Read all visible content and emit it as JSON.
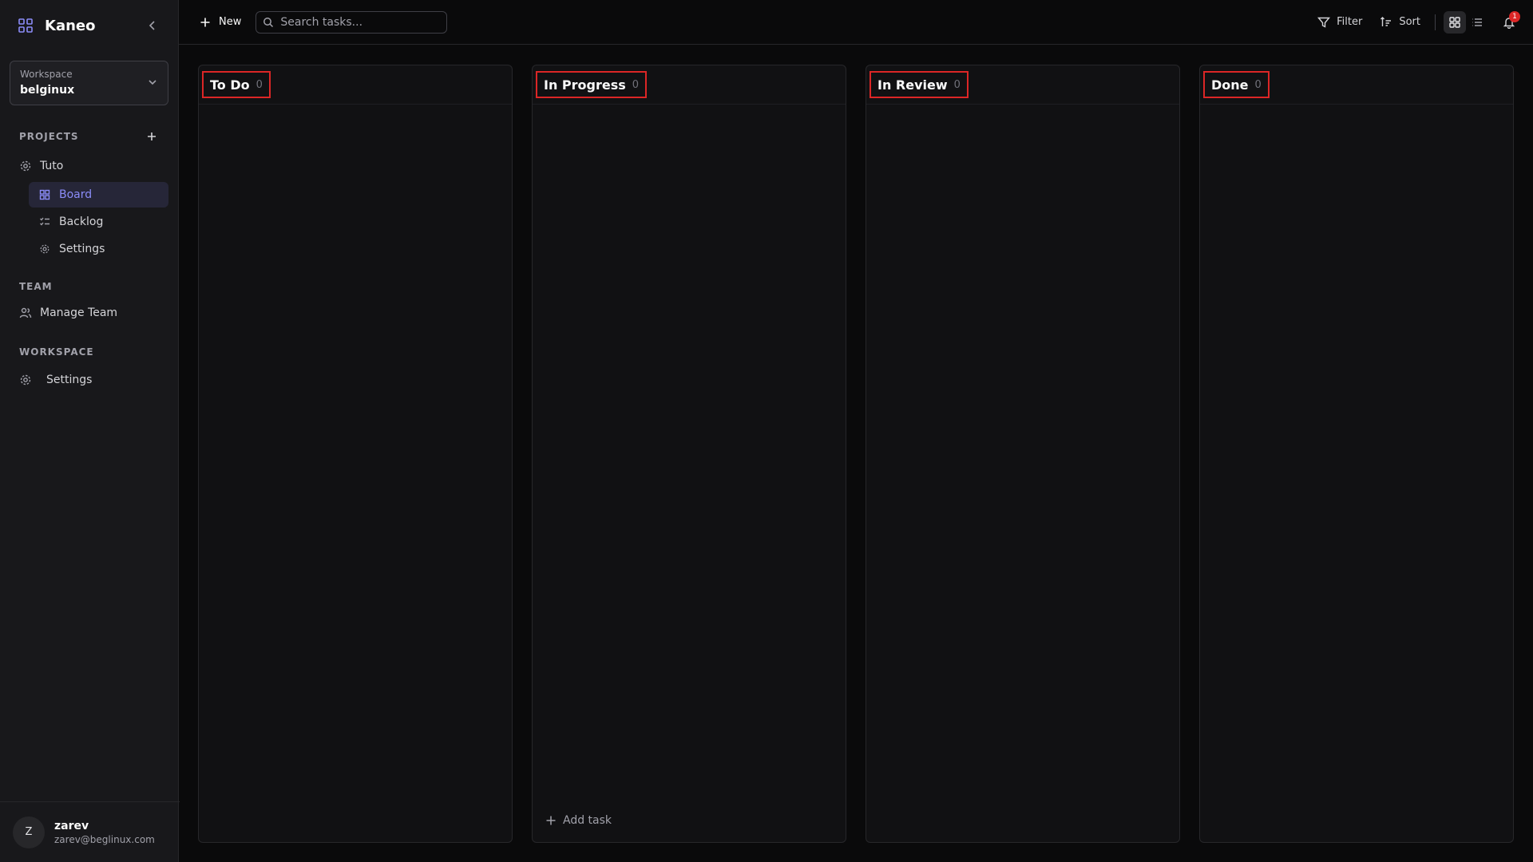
{
  "sidebar": {
    "brand": "Kaneo",
    "workspace_label": "Workspace",
    "workspace_value": "belginux",
    "projects_heading": "PROJECTS",
    "project_name": "Tuto",
    "project_items": [
      {
        "label": "Board"
      },
      {
        "label": "Backlog"
      },
      {
        "label": "Settings"
      }
    ],
    "team_heading": "TEAM",
    "team_item": "Manage Team",
    "workspace_heading": "WORKSPACE",
    "workspace_settings": "Settings",
    "user": {
      "initial": "Z",
      "name": "zarev",
      "email": "zarev@beglinux.com"
    }
  },
  "topbar": {
    "new_label": "New",
    "search_placeholder": "Search tasks...",
    "filter_label": "Filter",
    "sort_label": "Sort",
    "notification_count": "1"
  },
  "board": {
    "columns": [
      {
        "title": "To Do",
        "count": "0"
      },
      {
        "title": "In Progress",
        "count": "0"
      },
      {
        "title": "In Review",
        "count": "0"
      },
      {
        "title": "Done",
        "count": "0"
      }
    ],
    "add_task_label": "Add task"
  },
  "colors": {
    "accent": "#8b8cf8",
    "highlight_box": "#dc2626",
    "background": "#0a0a0b",
    "sidebar": "#18181b"
  }
}
